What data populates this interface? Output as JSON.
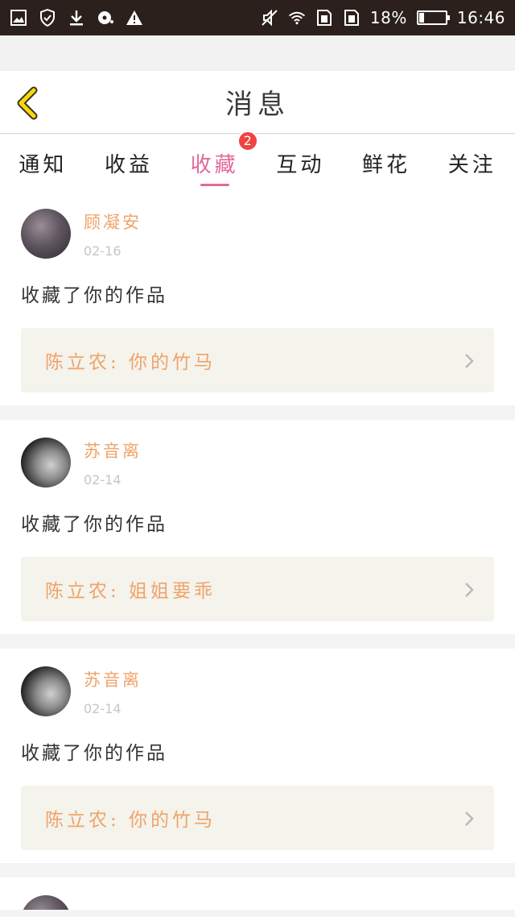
{
  "status_bar": {
    "battery": "18%",
    "battery_level": 0.18,
    "time": "16:46",
    "icons": [
      "gallery-icon",
      "shield-icon",
      "download-icon",
      "cd-icon",
      "warning-icon",
      "mute-icon",
      "wifi-icon",
      "sim1-icon",
      "sim2-icon"
    ]
  },
  "header": {
    "title": "消息",
    "back_icon": "chevron-left-icon",
    "accent": "#f5d90f"
  },
  "tabs": [
    {
      "label": "通知",
      "active": false
    },
    {
      "label": "收益",
      "active": false
    },
    {
      "label": "收藏",
      "active": true,
      "badge": "2"
    },
    {
      "label": "互动",
      "active": false
    },
    {
      "label": "鲜花",
      "active": false
    },
    {
      "label": "关注",
      "active": false
    }
  ],
  "colors": {
    "active_tab": "#e4689a",
    "badge": "#f0443f",
    "author": "#f0a36a",
    "work_bg": "#f4f3ec"
  },
  "feed": [
    {
      "author": "顾凝安",
      "date": "02-16",
      "action": "收藏了你的作品",
      "work": "陈立农: 你的竹马"
    },
    {
      "author": "苏音离",
      "date": "02-14",
      "action": "收藏了你的作品",
      "work": "陈立农: 姐姐要乖"
    },
    {
      "author": "苏音离",
      "date": "02-14",
      "action": "收藏了你的作品",
      "work": "陈立农: 你的竹马"
    }
  ]
}
